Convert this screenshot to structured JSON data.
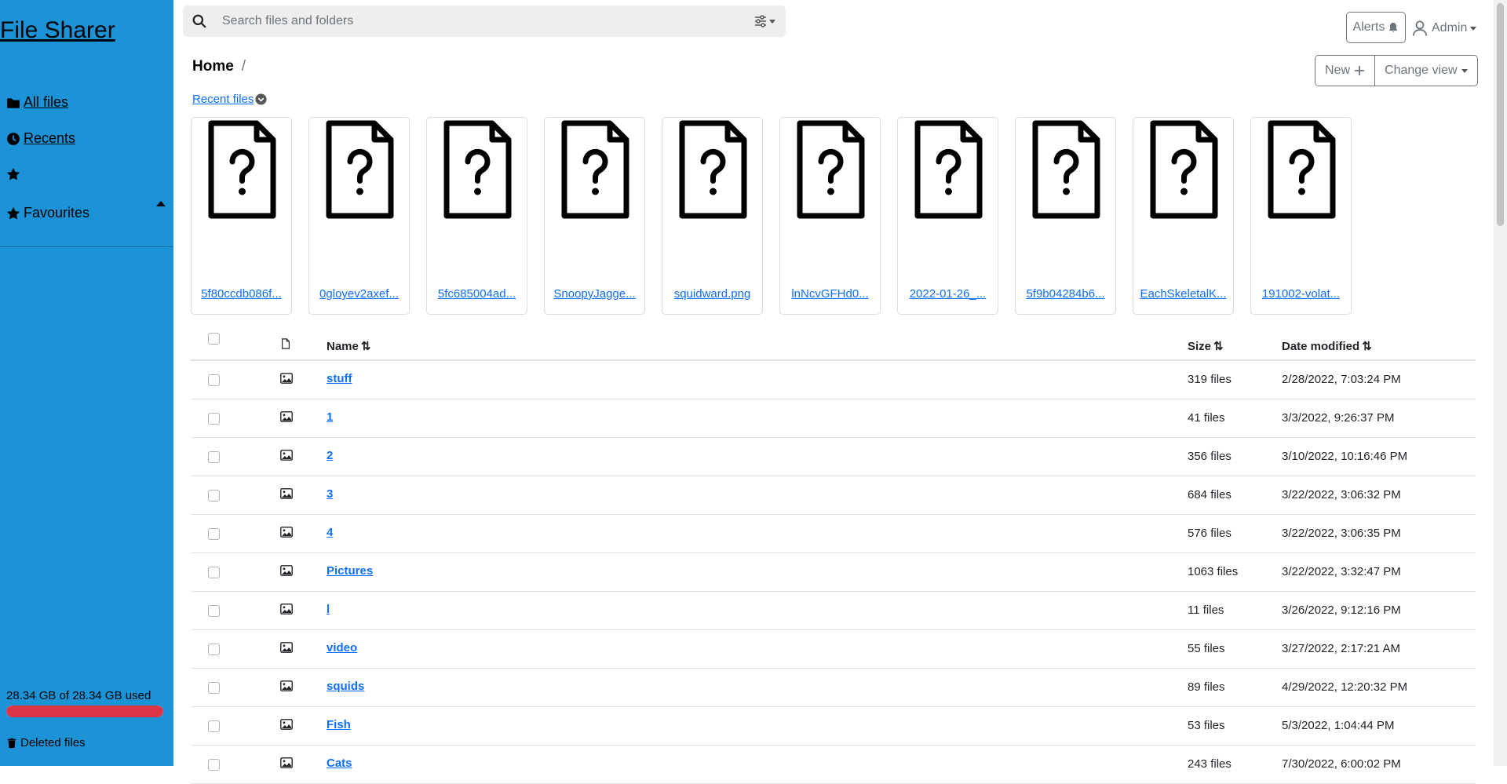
{
  "app": {
    "brand": "File Sharer"
  },
  "sidebar": {
    "items": [
      {
        "label": " All files",
        "icon": "folder-icon"
      },
      {
        "label": " Recents",
        "icon": "clock-icon"
      },
      {
        "label": "",
        "icon": "star-icon"
      },
      {
        "label": "Favourites",
        "icon": "star-icon"
      }
    ],
    "storage": {
      "text": "28.34 GB of 28.34 GB used",
      "used_fraction": 1.0,
      "bar_color": "#dc3545"
    },
    "deleted": "Deleted files"
  },
  "search": {
    "placeholder": "Search files and folders"
  },
  "header": {
    "alerts": "Alerts",
    "user": "Admin"
  },
  "breadcrumb": {
    "current": "Home",
    "separator": "/"
  },
  "toolbar": {
    "new_label": "New",
    "change_view_label": "Change view"
  },
  "recent": {
    "toggle_label": "Recent files",
    "files": [
      "5f80ccdb086f...",
      "0gloyev2axef...",
      "5fc685004ad...",
      "SnoopyJagge...",
      "squidward.png",
      "lnNcvGFHd0...",
      "2022-01-26_...",
      "5f9b04284b6...",
      "EachSkeletalK...",
      "191002-volat..."
    ]
  },
  "table": {
    "columns": {
      "name": "Name",
      "size": "Size",
      "date": "Date modified"
    },
    "rows": [
      {
        "name": "stuff",
        "size": "319 files",
        "date": "2/28/2022, 7:03:24 PM"
      },
      {
        "name": "1",
        "size": "41 files",
        "date": "3/3/2022, 9:26:37 PM"
      },
      {
        "name": "2",
        "size": "356 files",
        "date": "3/10/2022, 10:16:46 PM"
      },
      {
        "name": "3",
        "size": "684 files",
        "date": "3/22/2022, 3:06:32 PM"
      },
      {
        "name": "4",
        "size": "576 files",
        "date": "3/22/2022, 3:06:35 PM"
      },
      {
        "name": "Pictures",
        "size": "1063 files",
        "date": "3/22/2022, 3:32:47 PM"
      },
      {
        "name": "l",
        "size": "11 files",
        "date": "3/26/2022, 9:12:16 PM"
      },
      {
        "name": "video",
        "size": "55 files",
        "date": "3/27/2022, 2:17:21 AM"
      },
      {
        "name": "squids",
        "size": "89 files",
        "date": "4/29/2022, 12:20:32 PM"
      },
      {
        "name": "Fish",
        "size": "53 files",
        "date": "5/3/2022, 1:04:44 PM"
      },
      {
        "name": "Cats",
        "size": "243 files",
        "date": "7/30/2022, 6:00:02 PM"
      }
    ]
  }
}
